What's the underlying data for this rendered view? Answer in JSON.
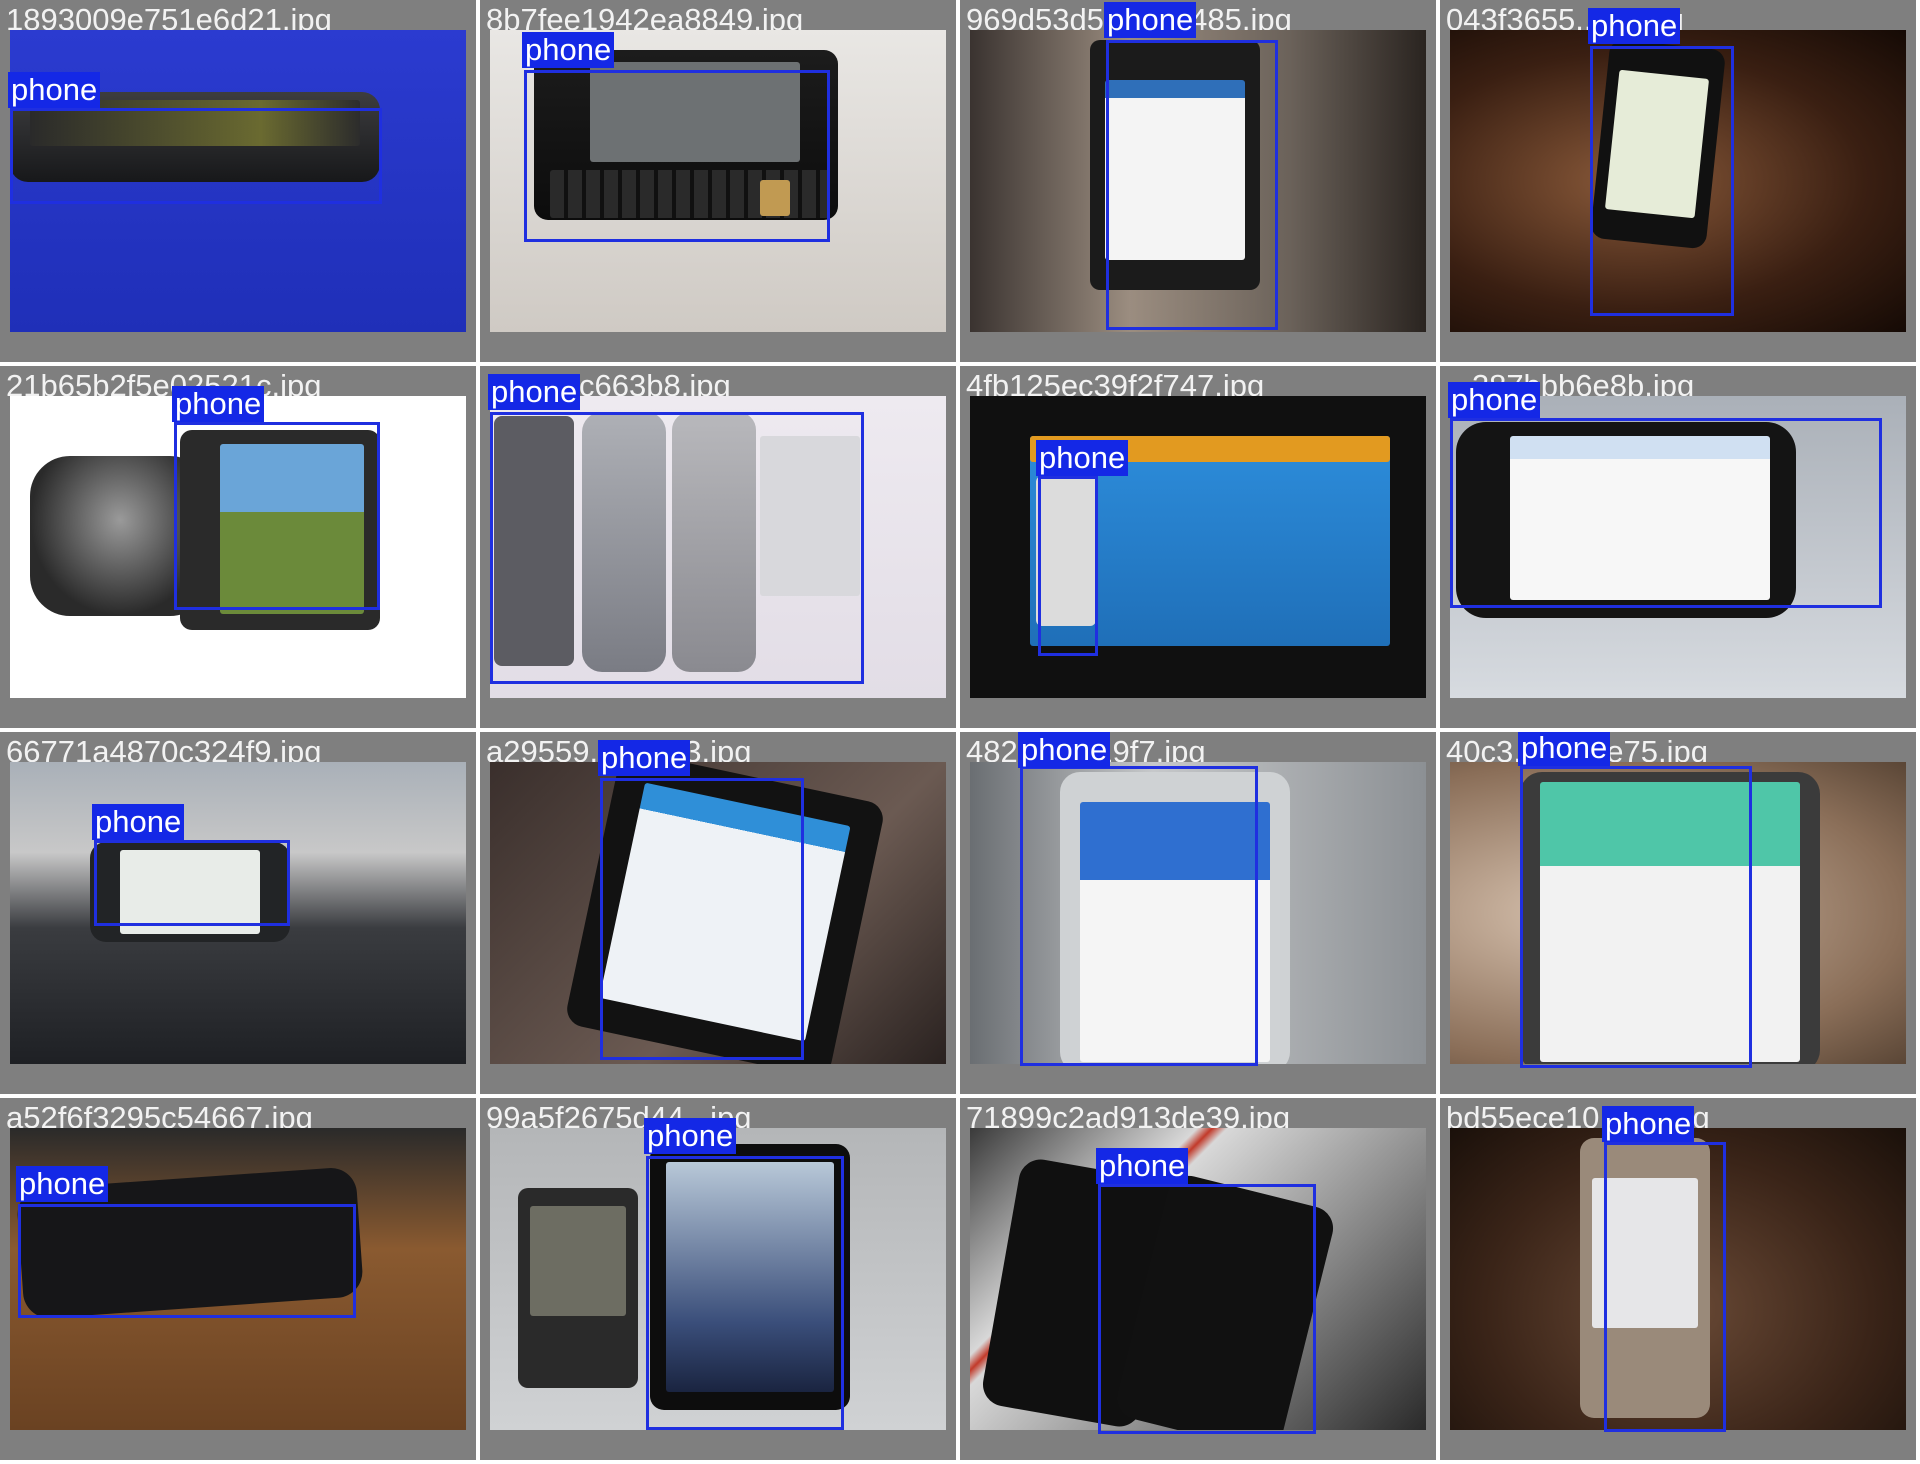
{
  "accent_color": "#1428e6",
  "tiles": [
    {
      "filename": "1893009e751e6d21.jpg",
      "label": "phone"
    },
    {
      "filename": "8b7fee1942ea8849.jpg",
      "label": "phone"
    },
    {
      "filename": "969d53d5phone485.jpg",
      "label": "phone"
    },
    {
      "filename": "043f3655...7c.jpg",
      "label": "phone"
    },
    {
      "filename": "21b65b2f5e02521c.jpg",
      "label": "phone"
    },
    {
      "filename": "...9c2ac663b8.jpg",
      "label": "phone"
    },
    {
      "filename": "4fb125ec39f2f747.jpg",
      "label": "phone"
    },
    {
      "filename": "...287bbb6e8b.jpg",
      "label": "phone"
    },
    {
      "filename": "66771a4870c324f9.jpg",
      "label": "phone"
    },
    {
      "filename": "a29559...0e3a3.jpg",
      "label": "phone"
    },
    {
      "filename": "482...80319f7.jpg",
      "label": "phone"
    },
    {
      "filename": "40c3...c703e75.jpg",
      "label": "phone"
    },
    {
      "filename": "a52f6f3295c54667.jpg",
      "label": "phone"
    },
    {
      "filename": "99a5f2675d44...jpg",
      "label": "phone"
    },
    {
      "filename": "71899c2ad913de39.jpg",
      "label": "phone"
    },
    {
      "filename": "bd55ece10...37.jpg",
      "label": "phone"
    }
  ]
}
